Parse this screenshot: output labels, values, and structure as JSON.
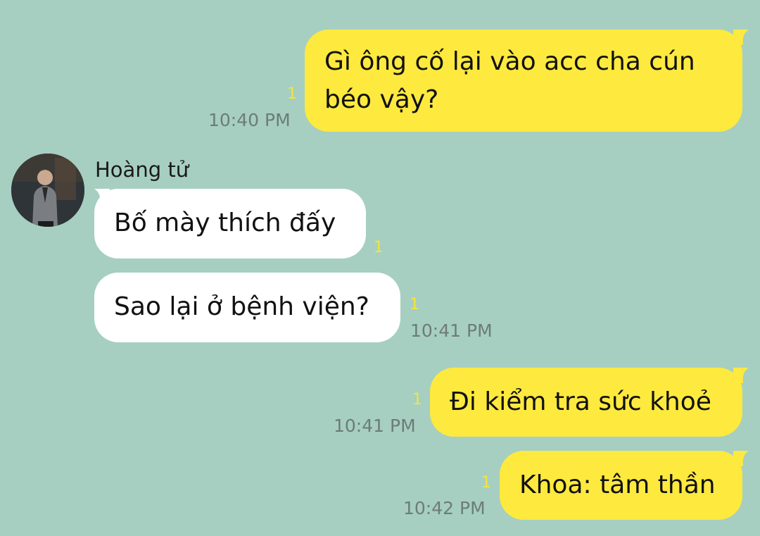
{
  "conversation": {
    "contact_name": "Hoàng tử",
    "messages": [
      {
        "direction": "outgoing",
        "text": "Gì ông cố lại vào acc cha cún béo vậy?",
        "read_count": "1",
        "time": "10:40 PM"
      },
      {
        "direction": "incoming",
        "text": "Bố mày thích đấy",
        "read_count": "1",
        "time": ""
      },
      {
        "direction": "incoming",
        "text": "Sao lại ở bệnh viện?",
        "read_count": "1",
        "time": "10:41 PM"
      },
      {
        "direction": "outgoing",
        "text": "Đi kiểm tra sức khoẻ",
        "read_count": "1",
        "time": "10:41 PM"
      },
      {
        "direction": "outgoing",
        "text": "Khoa: tâm thần",
        "read_count": "1",
        "time": "10:42 PM"
      }
    ]
  },
  "colors": {
    "background": "#a6cfc1",
    "outgoing_bubble": "#fee93f",
    "incoming_bubble": "#ffffff",
    "timestamp": "#6d7c78",
    "read_indicator": "#f4e53a"
  },
  "icons": {
    "avatar": "contact-avatar"
  }
}
